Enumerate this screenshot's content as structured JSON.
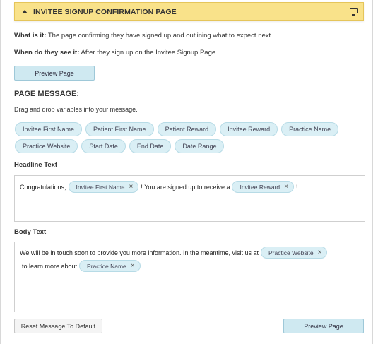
{
  "header": {
    "title": "INVITEE SIGNUP CONFIRMATION PAGE",
    "caret_icon": "caret-up-icon",
    "device_icon": "monitor-icon"
  },
  "info": {
    "what_label": "What is it:",
    "what_text": " The page confirming they have signed up and outlining what to expect next.",
    "when_label": "When do they see it:",
    "when_text": " After they sign up on the Invitee Signup Page."
  },
  "preview_top_label": "Preview Page",
  "page_message": {
    "title": "PAGE MESSAGE:",
    "instructions": "Drag and drop variables into your message."
  },
  "variables": [
    "Invitee First Name",
    "Patient First Name",
    "Patient Reward",
    "Invitee Reward",
    "Practice Name",
    "Practice Website",
    "Start Date",
    "End Date",
    "Date Range"
  ],
  "headline": {
    "label": "Headline Text",
    "text1": "Congratulations,",
    "token1": "Invitee First Name",
    "text2": "! You are signed up to receive a",
    "token2": "Invitee Reward",
    "text3": "!"
  },
  "body": {
    "label": "Body Text",
    "line1_text": "We will be in touch soon to provide you more information. In the meantime, visit us at",
    "line1_token": "Practice Website",
    "line2_text": "to learn more about",
    "line2_token": "Practice Name",
    "line2_end": "."
  },
  "footer": {
    "reset_label": "Reset Message To Default",
    "preview_label": "Preview Page"
  },
  "remove_glyph": "×"
}
